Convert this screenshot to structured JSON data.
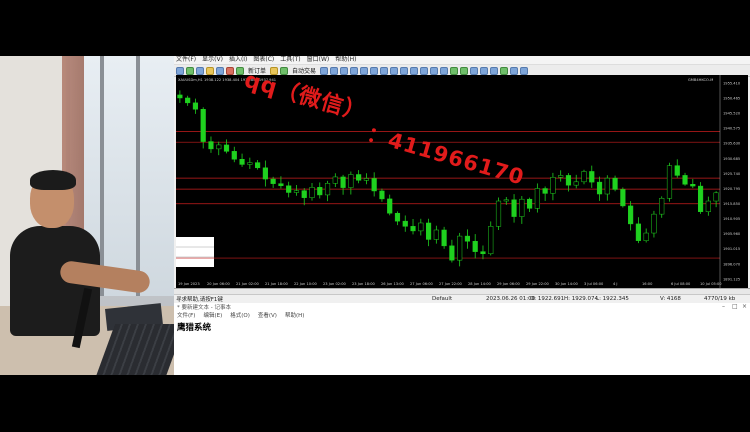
{
  "menu": [
    "文件(F)",
    "显示(V)",
    "插入(I)",
    "图表(C)",
    "工具(T)",
    "窗口(W)",
    "帮助(H)"
  ],
  "toolbar": {
    "new_order": "新订单",
    "auto_trading": "自动交易"
  },
  "chart": {
    "symbol_info": "XAUUSDm,H1  1938.122 1938.404 1937.802 1937.941",
    "corner_label": "GMB4HKCO-M",
    "price_labels": [
      "1955.410",
      "1950.465",
      "1945.520",
      "1940.575",
      "1935.630",
      "1930.685",
      "1925.740",
      "1920.795",
      "1915.850",
      "1910.905",
      "1905.960",
      "1901.015",
      "1896.070",
      "1891.125"
    ],
    "time_labels": [
      "19 Jun 2023",
      "20 Jun 06:00",
      "21 Jun 02:00",
      "21 Jun 18:00",
      "22 Jun 10:00",
      "23 Jun 02:00",
      "23 Jun 18:00",
      "26 Jun 13:00",
      "27 Jun 06:00",
      "27 Jun 22:00",
      "28 Jun 14:00",
      "29 Jun 06:00",
      "29 Jun 22:00",
      "30 Jun 14:00",
      "3 Jul 06:00",
      "4 J",
      "16:00",
      "6 Jul 08:00",
      "10 Jul 05:00"
    ],
    "close_price": [
      1950.5,
      1948.9,
      1946.8,
      1936.2,
      1933.8,
      1935.1,
      1933.0,
      1930.4,
      1928.7,
      1929.3,
      1927.6,
      1923.9,
      1922.4,
      1921.7,
      1919.5,
      1920.1,
      1917.8,
      1921.2,
      1918.7,
      1922.5,
      1924.6,
      1921.1,
      1925.4,
      1923.5,
      1924.1,
      1920.0,
      1917.4,
      1912.7,
      1910.1,
      1908.4,
      1906.9,
      1909.5,
      1904.1,
      1907.2,
      1902.0,
      1897.3,
      1905.2,
      1903.5,
      1900.1,
      1899.4,
      1908.4,
      1916.7,
      1917.1,
      1911.6,
      1917.3,
      1914.3,
      1920.8,
      1919.2,
      1924.5,
      1925.1,
      1921.9,
      1923.0,
      1926.4,
      1922.9,
      1919.0,
      1924.2,
      1920.5,
      1915.1,
      1909.2,
      1903.7,
      1906.2,
      1912.4,
      1917.6,
      1928.3,
      1925.1,
      1922.2,
      1921.6,
      1913.2,
      1916.7,
      1919.4
    ],
    "horizontal_levels": [
      1939.5,
      1936.0,
      1924.2,
      1920.6,
      1915.8,
      1898.0
    ]
  },
  "status": {
    "help": "寻求帮助,请按F1键",
    "profile": "Default",
    "datetime": "2023.06.26 01:00",
    "open": "O: 1922.691",
    "high": "H: 1929.074",
    "low": "L: 1922.345",
    "volume": "V: 4168",
    "traffic": "4770/19 kb"
  },
  "notepad": {
    "title": "* 要新建文本 - 记事本",
    "menu": [
      "文件(F)",
      "编辑(E)",
      "格式(O)",
      "查看(V)",
      "帮助(H)"
    ],
    "content": "鹰猎系统"
  },
  "watermark": {
    "line1": "qq（微信）",
    "line2": "：411966170"
  },
  "colors": {
    "candle": "#1fd11f",
    "level": "#c81e1e",
    "watermark": "#e11b1b"
  }
}
